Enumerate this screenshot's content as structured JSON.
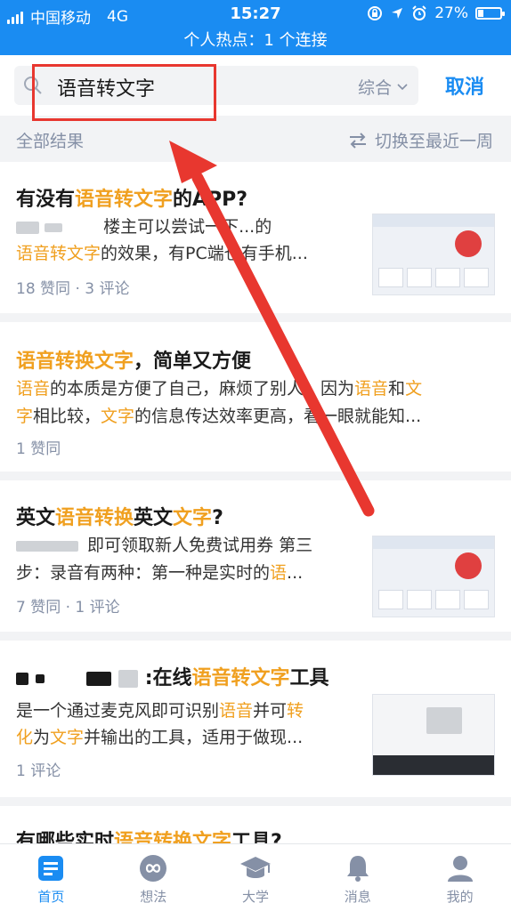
{
  "status": {
    "carrier": "中国移动",
    "network": "4G",
    "time": "15:27",
    "battery": "27%",
    "battery_level": 0.27,
    "hotspot": "个人热点：1 个连接"
  },
  "search": {
    "query": "语音转文字",
    "scope": "综合",
    "cancel": "取消"
  },
  "filter": {
    "all_results": "全部结果",
    "switch_recent": "切换至最近一周"
  },
  "results": [
    {
      "title": [
        {
          "t": "有没有",
          "h": false
        },
        {
          "t": "语音转文字",
          "h": true
        },
        {
          "t": "的APP?",
          "h": false
        }
      ],
      "line1": [
        {
          "t": "楼主可以尝试一下...",
          "h": false
        },
        {
          "t": "的",
          "h": false
        }
      ],
      "line2": [
        {
          "t": "语音转文字",
          "h": true
        },
        {
          "t": "的效果，有PC端也有手机...",
          "h": false
        }
      ],
      "meta": "18 赞同 · 3 评论"
    },
    {
      "title": [
        {
          "t": "语音转换文字",
          "h": true
        },
        {
          "t": "，简单又方便",
          "h": false
        }
      ],
      "line1": [
        {
          "t": "语音",
          "h": true
        },
        {
          "t": "的本质是方便了自己，麻烦了别人。因为",
          "h": false
        },
        {
          "t": "语音",
          "h": true
        },
        {
          "t": "和",
          "h": false
        },
        {
          "t": "文",
          "h": true
        }
      ],
      "line2": [
        {
          "t": "字",
          "h": true
        },
        {
          "t": "相比较，",
          "h": false
        },
        {
          "t": "文字",
          "h": true
        },
        {
          "t": "的信息传达效率更高，看一眼就能知...",
          "h": false
        }
      ],
      "meta": "1 赞同"
    },
    {
      "title": [
        {
          "t": "英文",
          "h": false
        },
        {
          "t": "语音转换",
          "h": true
        },
        {
          "t": "英文",
          "h": false
        },
        {
          "t": "文字",
          "h": true
        },
        {
          "t": "?",
          "h": false
        }
      ],
      "line1": [
        {
          "t": "即可领取新人免费试用券 第三",
          "h": false
        }
      ],
      "line2": [
        {
          "t": "步：录音有两种：第一种是实时的",
          "h": false
        },
        {
          "t": "语",
          "h": true
        },
        {
          "t": "...",
          "h": false
        }
      ],
      "meta": "7 赞同 · 1 评论"
    },
    {
      "title": [
        {
          "t": ":在线",
          "h": false
        },
        {
          "t": "语音转文字",
          "h": true
        },
        {
          "t": "工具",
          "h": false
        }
      ],
      "line1": [
        {
          "t": "是一个通过麦克风即可识别",
          "h": false
        },
        {
          "t": "语音",
          "h": true
        },
        {
          "t": "并可",
          "h": false
        },
        {
          "t": "转",
          "h": true
        }
      ],
      "line2": [
        {
          "t": "化",
          "h": true
        },
        {
          "t": "为",
          "h": false
        },
        {
          "t": "文字",
          "h": true
        },
        {
          "t": "并输出的工具，适用于做现...",
          "h": false
        }
      ],
      "meta": "1 评论"
    },
    {
      "title": [
        {
          "t": "有哪些实时",
          "h": false
        },
        {
          "t": "语音转换文字",
          "h": true
        },
        {
          "t": "工具?",
          "h": false
        }
      ]
    }
  ],
  "tabs": [
    {
      "label": "首页",
      "icon": "home-icon"
    },
    {
      "label": "想法",
      "icon": "ideas-icon"
    },
    {
      "label": "大学",
      "icon": "graduation-cap-icon"
    },
    {
      "label": "消息",
      "icon": "bell-icon"
    },
    {
      "label": "我的",
      "icon": "profile-icon"
    }
  ],
  "colors": {
    "brand": "#1a8cf2",
    "highlight": "#f0a020",
    "annotation": "#e8372f"
  }
}
